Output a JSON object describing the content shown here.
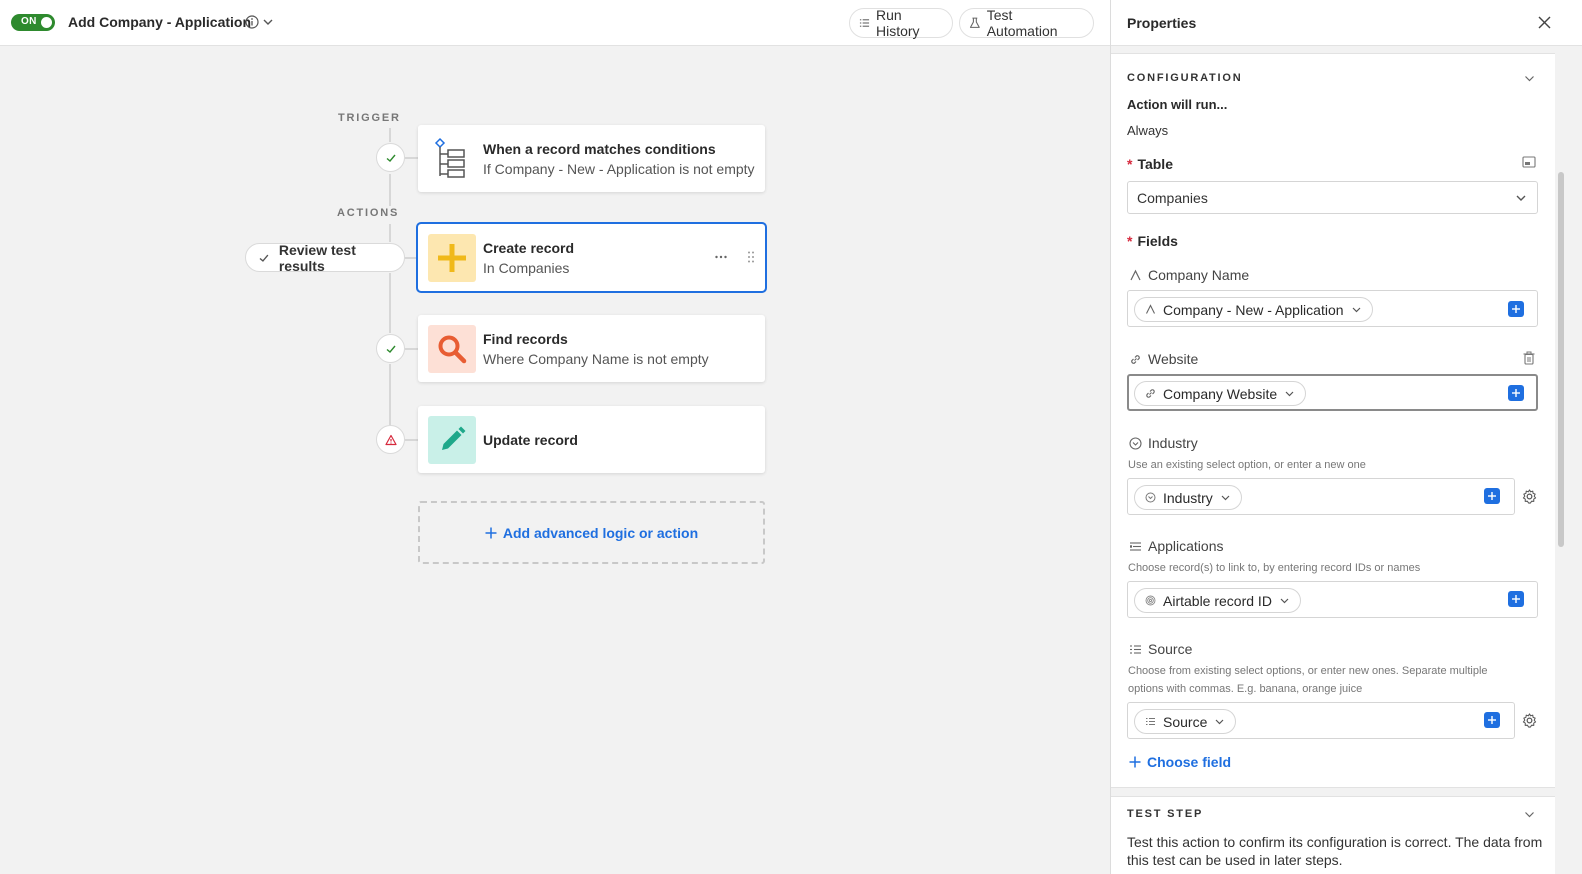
{
  "header": {
    "toggle_label": "ON",
    "title": "Add Company - Application",
    "run_history": "Run History",
    "test_automation": "Test Automation"
  },
  "canvas": {
    "trigger_label": "TRIGGER",
    "actions_label": "ACTIONS",
    "review_label": "Review test results",
    "trigger_card": {
      "title": "When a record matches conditions",
      "sub": "If Company - New - Application is not empty"
    },
    "create_card": {
      "title": "Create record",
      "sub": "In Companies"
    },
    "find_card": {
      "title": "Find records",
      "sub": "Where Company Name is not empty"
    },
    "update_card": {
      "title": "Update record"
    },
    "add_label": "Add advanced logic or action"
  },
  "panel": {
    "title": "Properties",
    "configuration": "CONFIGURATION",
    "action_will_run": "Action will run...",
    "run_value": "Always",
    "table_label": "Table",
    "table_value": "Companies",
    "fields_label": "Fields",
    "fields": {
      "company_name": {
        "label": "Company Name",
        "token": "Company - New - Application"
      },
      "website": {
        "label": "Website",
        "token": "Company Website"
      },
      "industry": {
        "label": "Industry",
        "hint": "Use an existing select option, or enter a new one",
        "token": "Industry"
      },
      "applications": {
        "label": "Applications",
        "hint": "Choose record(s) to link to, by entering record IDs or names",
        "token": "Airtable record ID"
      },
      "source": {
        "label": "Source",
        "hint1": "Choose from existing select options, or enter new ones. Separate multiple",
        "hint2": "options with commas. E.g. banana, orange juice",
        "token": "Source"
      }
    },
    "choose_field": "Choose field",
    "test_step": "TEST STEP",
    "test_desc1": "Test this action to confirm its configuration is correct. The data from",
    "test_desc2": "this test can be used in later steps."
  },
  "colors": {
    "accent": "#1f6fe0",
    "toggle_on": "#2e8a2e",
    "create_icon_bg": "#fde7b0",
    "find_icon_bg": "#fde0d6",
    "update_icon_bg": "#c9f0e8",
    "warning": "#d6293d"
  }
}
